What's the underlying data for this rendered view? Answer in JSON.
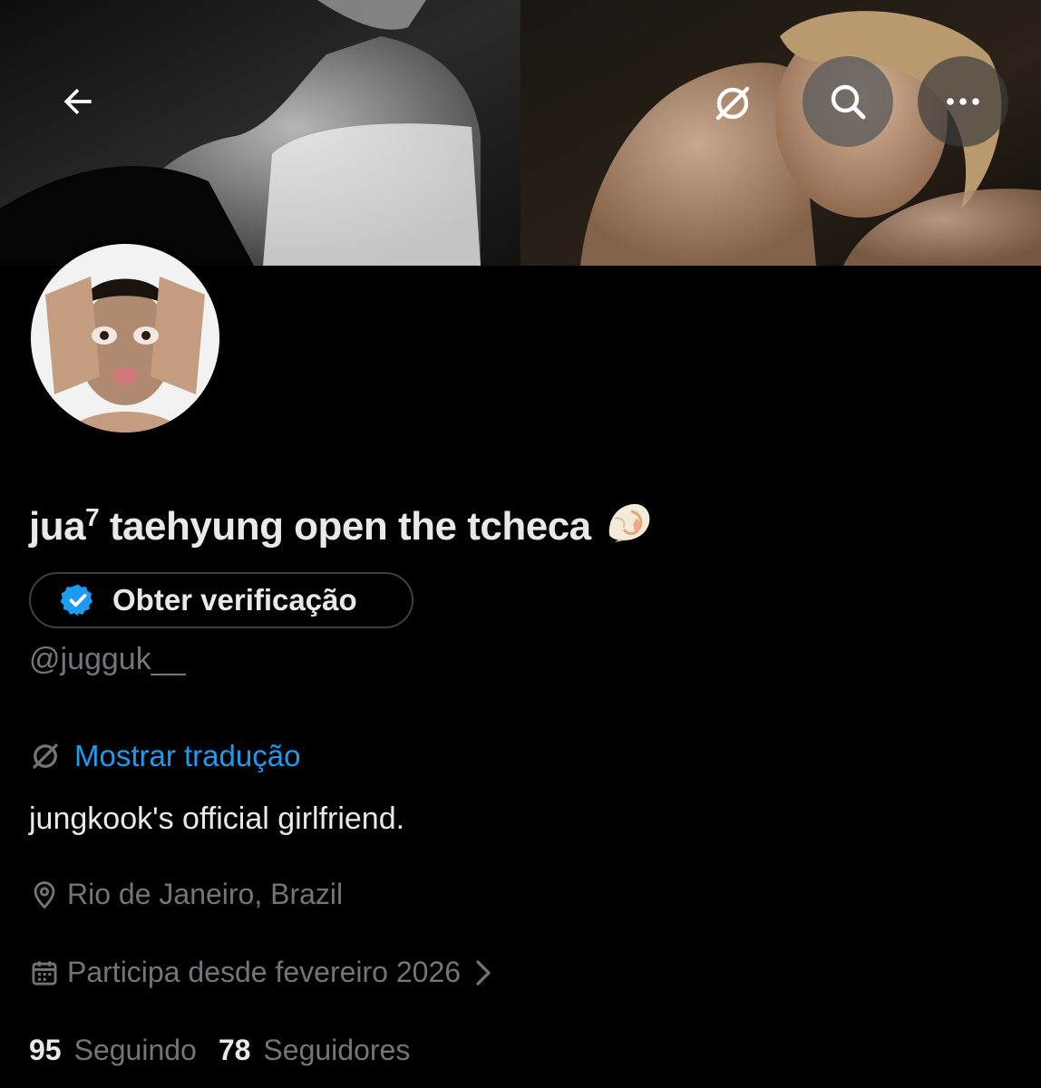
{
  "header": {
    "back_icon": "arrow-left-icon",
    "translate_icon": "translate-globe-icon",
    "search_icon": "search-icon",
    "more_icon": "more-horizontal-icon"
  },
  "profile": {
    "display_name_main": "jua",
    "display_name_sup": "7",
    "display_name_rest": " taehyung open the tcheca",
    "display_name_emoji": "shell-icon",
    "verify_button_label": "Obter verificação",
    "handle": "@jugguk__",
    "translate_label": "Mostrar tradução",
    "bio": "jungkook's official girlfriend.",
    "location": "Rio de Janeiro, Brazil",
    "joined": "Participa desde fevereiro 2026",
    "following_count": "95",
    "following_label": "Seguindo",
    "followers_count": "78",
    "followers_label": "Seguidores"
  },
  "colors": {
    "background": "#000000",
    "text_primary": "#e7e9ea",
    "text_secondary": "#71767b",
    "accent": "#1d9bf0",
    "border": "#3e4144"
  }
}
